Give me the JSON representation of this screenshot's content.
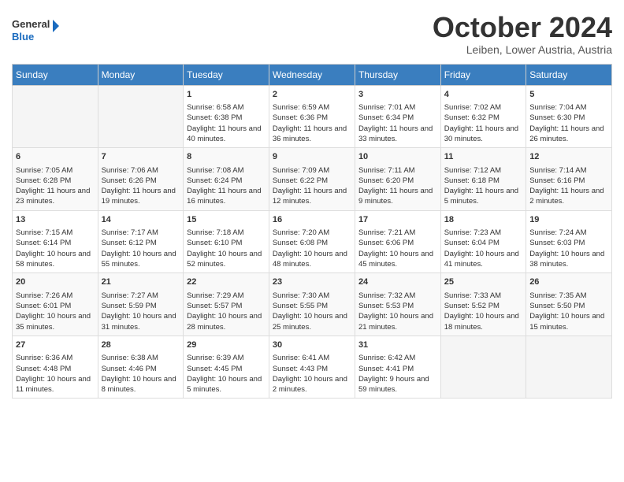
{
  "header": {
    "logo": {
      "line1": "General",
      "line2": "Blue"
    },
    "title": "October 2024",
    "location": "Leiben, Lower Austria, Austria"
  },
  "days_of_week": [
    "Sunday",
    "Monday",
    "Tuesday",
    "Wednesday",
    "Thursday",
    "Friday",
    "Saturday"
  ],
  "weeks": [
    [
      {
        "day": "",
        "info": ""
      },
      {
        "day": "",
        "info": ""
      },
      {
        "day": "1",
        "sunrise": "Sunrise: 6:58 AM",
        "sunset": "Sunset: 6:38 PM",
        "daylight": "Daylight: 11 hours and 40 minutes."
      },
      {
        "day": "2",
        "sunrise": "Sunrise: 6:59 AM",
        "sunset": "Sunset: 6:36 PM",
        "daylight": "Daylight: 11 hours and 36 minutes."
      },
      {
        "day": "3",
        "sunrise": "Sunrise: 7:01 AM",
        "sunset": "Sunset: 6:34 PM",
        "daylight": "Daylight: 11 hours and 33 minutes."
      },
      {
        "day": "4",
        "sunrise": "Sunrise: 7:02 AM",
        "sunset": "Sunset: 6:32 PM",
        "daylight": "Daylight: 11 hours and 30 minutes."
      },
      {
        "day": "5",
        "sunrise": "Sunrise: 7:04 AM",
        "sunset": "Sunset: 6:30 PM",
        "daylight": "Daylight: 11 hours and 26 minutes."
      }
    ],
    [
      {
        "day": "6",
        "sunrise": "Sunrise: 7:05 AM",
        "sunset": "Sunset: 6:28 PM",
        "daylight": "Daylight: 11 hours and 23 minutes."
      },
      {
        "day": "7",
        "sunrise": "Sunrise: 7:06 AM",
        "sunset": "Sunset: 6:26 PM",
        "daylight": "Daylight: 11 hours and 19 minutes."
      },
      {
        "day": "8",
        "sunrise": "Sunrise: 7:08 AM",
        "sunset": "Sunset: 6:24 PM",
        "daylight": "Daylight: 11 hours and 16 minutes."
      },
      {
        "day": "9",
        "sunrise": "Sunrise: 7:09 AM",
        "sunset": "Sunset: 6:22 PM",
        "daylight": "Daylight: 11 hours and 12 minutes."
      },
      {
        "day": "10",
        "sunrise": "Sunrise: 7:11 AM",
        "sunset": "Sunset: 6:20 PM",
        "daylight": "Daylight: 11 hours and 9 minutes."
      },
      {
        "day": "11",
        "sunrise": "Sunrise: 7:12 AM",
        "sunset": "Sunset: 6:18 PM",
        "daylight": "Daylight: 11 hours and 5 minutes."
      },
      {
        "day": "12",
        "sunrise": "Sunrise: 7:14 AM",
        "sunset": "Sunset: 6:16 PM",
        "daylight": "Daylight: 11 hours and 2 minutes."
      }
    ],
    [
      {
        "day": "13",
        "sunrise": "Sunrise: 7:15 AM",
        "sunset": "Sunset: 6:14 PM",
        "daylight": "Daylight: 10 hours and 58 minutes."
      },
      {
        "day": "14",
        "sunrise": "Sunrise: 7:17 AM",
        "sunset": "Sunset: 6:12 PM",
        "daylight": "Daylight: 10 hours and 55 minutes."
      },
      {
        "day": "15",
        "sunrise": "Sunrise: 7:18 AM",
        "sunset": "Sunset: 6:10 PM",
        "daylight": "Daylight: 10 hours and 52 minutes."
      },
      {
        "day": "16",
        "sunrise": "Sunrise: 7:20 AM",
        "sunset": "Sunset: 6:08 PM",
        "daylight": "Daylight: 10 hours and 48 minutes."
      },
      {
        "day": "17",
        "sunrise": "Sunrise: 7:21 AM",
        "sunset": "Sunset: 6:06 PM",
        "daylight": "Daylight: 10 hours and 45 minutes."
      },
      {
        "day": "18",
        "sunrise": "Sunrise: 7:23 AM",
        "sunset": "Sunset: 6:04 PM",
        "daylight": "Daylight: 10 hours and 41 minutes."
      },
      {
        "day": "19",
        "sunrise": "Sunrise: 7:24 AM",
        "sunset": "Sunset: 6:03 PM",
        "daylight": "Daylight: 10 hours and 38 minutes."
      }
    ],
    [
      {
        "day": "20",
        "sunrise": "Sunrise: 7:26 AM",
        "sunset": "Sunset: 6:01 PM",
        "daylight": "Daylight: 10 hours and 35 minutes."
      },
      {
        "day": "21",
        "sunrise": "Sunrise: 7:27 AM",
        "sunset": "Sunset: 5:59 PM",
        "daylight": "Daylight: 10 hours and 31 minutes."
      },
      {
        "day": "22",
        "sunrise": "Sunrise: 7:29 AM",
        "sunset": "Sunset: 5:57 PM",
        "daylight": "Daylight: 10 hours and 28 minutes."
      },
      {
        "day": "23",
        "sunrise": "Sunrise: 7:30 AM",
        "sunset": "Sunset: 5:55 PM",
        "daylight": "Daylight: 10 hours and 25 minutes."
      },
      {
        "day": "24",
        "sunrise": "Sunrise: 7:32 AM",
        "sunset": "Sunset: 5:53 PM",
        "daylight": "Daylight: 10 hours and 21 minutes."
      },
      {
        "day": "25",
        "sunrise": "Sunrise: 7:33 AM",
        "sunset": "Sunset: 5:52 PM",
        "daylight": "Daylight: 10 hours and 18 minutes."
      },
      {
        "day": "26",
        "sunrise": "Sunrise: 7:35 AM",
        "sunset": "Sunset: 5:50 PM",
        "daylight": "Daylight: 10 hours and 15 minutes."
      }
    ],
    [
      {
        "day": "27",
        "sunrise": "Sunrise: 6:36 AM",
        "sunset": "Sunset: 4:48 PM",
        "daylight": "Daylight: 10 hours and 11 minutes."
      },
      {
        "day": "28",
        "sunrise": "Sunrise: 6:38 AM",
        "sunset": "Sunset: 4:46 PM",
        "daylight": "Daylight: 10 hours and 8 minutes."
      },
      {
        "day": "29",
        "sunrise": "Sunrise: 6:39 AM",
        "sunset": "Sunset: 4:45 PM",
        "daylight": "Daylight: 10 hours and 5 minutes."
      },
      {
        "day": "30",
        "sunrise": "Sunrise: 6:41 AM",
        "sunset": "Sunset: 4:43 PM",
        "daylight": "Daylight: 10 hours and 2 minutes."
      },
      {
        "day": "31",
        "sunrise": "Sunrise: 6:42 AM",
        "sunset": "Sunset: 4:41 PM",
        "daylight": "Daylight: 9 hours and 59 minutes."
      },
      {
        "day": "",
        "info": ""
      },
      {
        "day": "",
        "info": ""
      }
    ]
  ]
}
